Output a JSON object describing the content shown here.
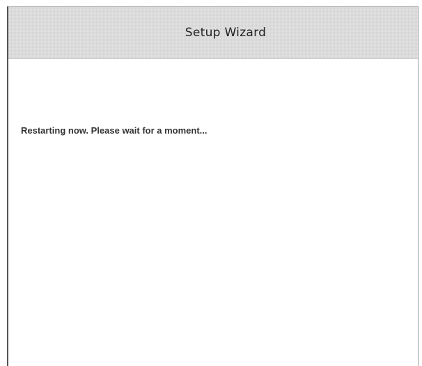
{
  "wizard": {
    "title": "Setup Wizard",
    "status_message": "Restarting now. Please wait for a moment..."
  }
}
